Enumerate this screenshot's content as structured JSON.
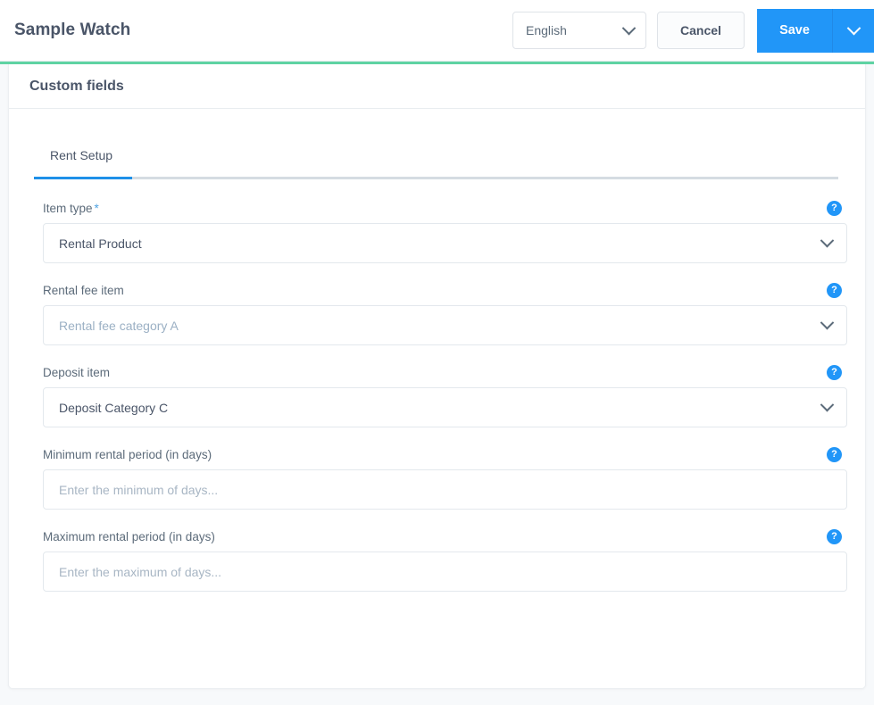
{
  "topbar": {
    "title": "Sample Watch",
    "language_select": {
      "value": "English",
      "caret_icon": "chevron-down-icon"
    },
    "cancel_label": "Cancel",
    "save_label": "Save",
    "save_caret_icon": "chevron-down-icon"
  },
  "colors": {
    "accent_green": "#5fd3a3",
    "primary_blue": "#2196f8",
    "tab_active_blue": "#1e90e8",
    "help_blue": "#2196f8"
  },
  "card": {
    "header_title": "Custom fields"
  },
  "tabs": [
    {
      "label": "Rent Setup",
      "active": true
    }
  ],
  "form": {
    "help_icon_glyph": "?",
    "required_marker": "*",
    "fields": [
      {
        "label": "Item type",
        "required": true,
        "type": "select",
        "value": "Rental Product",
        "muted": false,
        "help": true
      },
      {
        "label": "Rental fee item",
        "required": false,
        "type": "select",
        "value": "Rental fee category A",
        "muted": true,
        "help": true
      },
      {
        "label": "Deposit item",
        "required": false,
        "type": "select",
        "value": "Deposit Category C",
        "muted": false,
        "help": true
      },
      {
        "label": "Minimum rental period (in days)",
        "required": false,
        "type": "text",
        "placeholder": "Enter the minimum of days...",
        "value": "",
        "help": true
      },
      {
        "label": "Maximum rental period (in days)",
        "required": false,
        "type": "text",
        "placeholder": "Enter the maximum of days...",
        "value": "",
        "help": true
      }
    ]
  }
}
